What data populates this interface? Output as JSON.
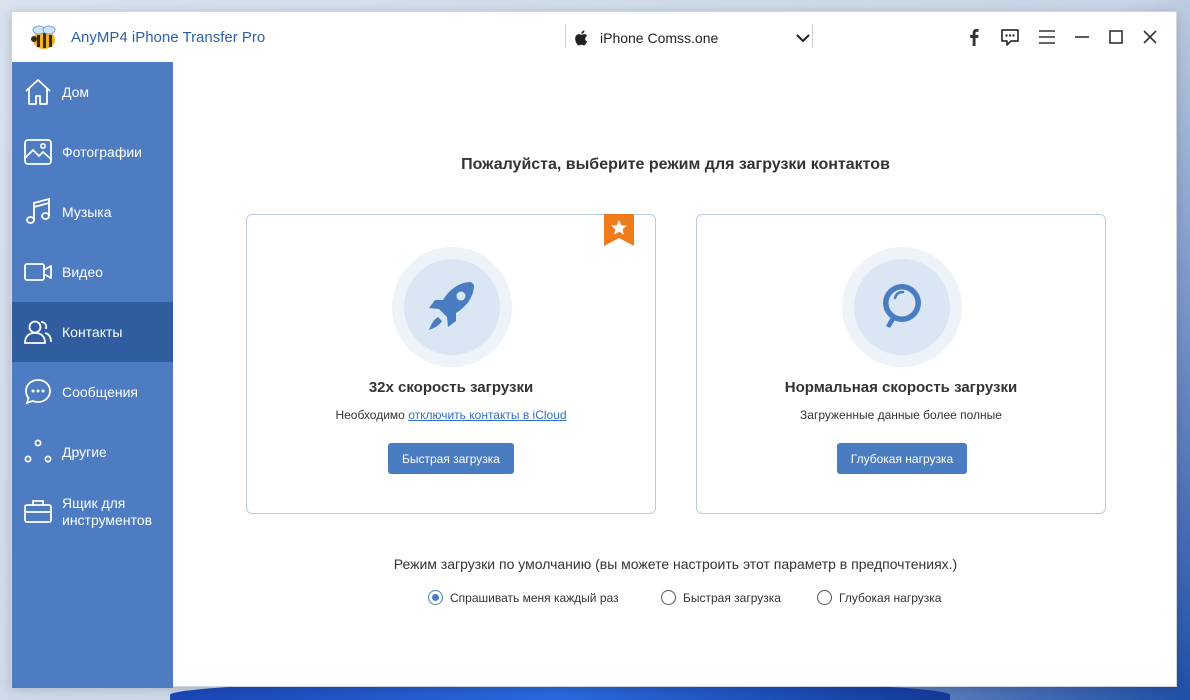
{
  "app": {
    "title": "AnyMP4 iPhone Transfer Pro",
    "device_name": "iPhone Comss.one"
  },
  "titlebar_icons": [
    "facebook-icon",
    "feedback-icon",
    "menu-icon",
    "minimize-icon",
    "maximize-icon",
    "close-icon"
  ],
  "sidebar": {
    "items": [
      {
        "label": "Дом",
        "icon": "home-icon",
        "active": false
      },
      {
        "label": "Фотографии",
        "icon": "photo-icon",
        "active": false
      },
      {
        "label": "Музыка",
        "icon": "music-icon",
        "active": false
      },
      {
        "label": "Видео",
        "icon": "video-icon",
        "active": false
      },
      {
        "label": "Контакты",
        "icon": "contacts-icon",
        "active": true
      },
      {
        "label": "Сообщения",
        "icon": "messages-icon",
        "active": false
      },
      {
        "label": "Другие",
        "icon": "other-icon",
        "active": false
      },
      {
        "label": "Ящик для инструментов",
        "icon": "toolbox-icon",
        "active": false
      }
    ]
  },
  "main": {
    "heading": "Пожалуйста, выберите режим для загрузки контактов",
    "fast_card": {
      "title": "32x скорость загрузки",
      "note_prefix": "Необходимо",
      "note_link": "отключить контакты в iCloud",
      "button": "Быстрая загрузка"
    },
    "deep_card": {
      "title": "Нормальная скорость загрузки",
      "note": "Загруженные данные более полные",
      "button": "Глубокая нагрузка"
    },
    "default_mode_text": "Режим загрузки по умолчанию (вы можете настроить этот параметр в предпочтениях.)",
    "radio_options": [
      {
        "label": "Спрашивать меня каждый раз",
        "checked": true
      },
      {
        "label": "Быстрая загрузка",
        "checked": false
      },
      {
        "label": "Глубокая нагрузка",
        "checked": false
      }
    ]
  },
  "colors": {
    "sidebar": "#4d7cc3",
    "sidebar_active": "#2f5da0",
    "button": "#4a7cc2",
    "ribbon": "#f07b1a",
    "link": "#2f6fc6"
  }
}
